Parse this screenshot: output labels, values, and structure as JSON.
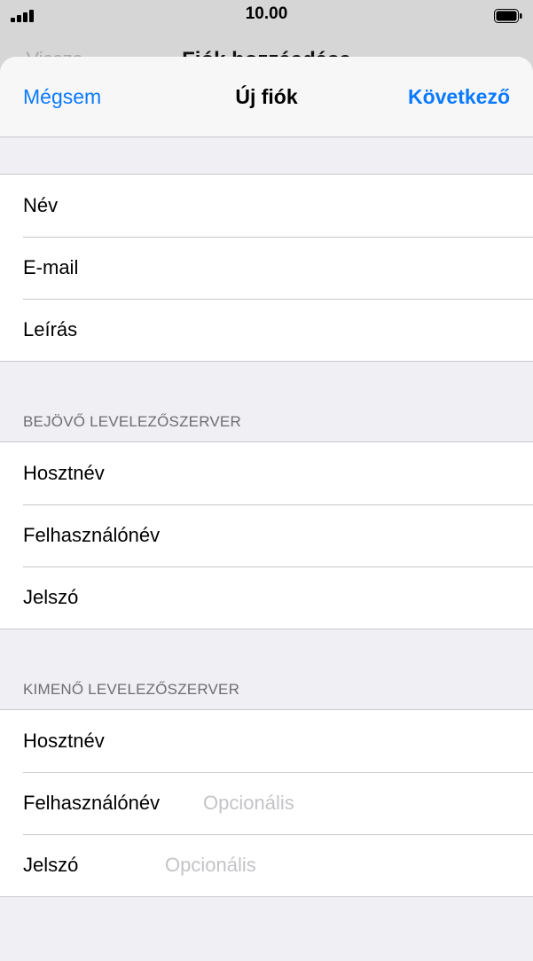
{
  "status_bar": {
    "time": "10.00",
    "signal_icon": "signal-bars-icon",
    "battery_icon": "battery-full-icon"
  },
  "background_nav": {
    "back_label": "Vissza",
    "title": "Fiók hozzáadása"
  },
  "sheet": {
    "cancel_label": "Mégsem",
    "title": "Új fiók",
    "next_label": "Következő"
  },
  "account_fields": [
    {
      "label": "Név",
      "placeholder": "",
      "value": ""
    },
    {
      "label": "E-mail",
      "placeholder": "",
      "value": ""
    },
    {
      "label": "Leírás",
      "placeholder": "",
      "value": ""
    }
  ],
  "incoming": {
    "header": "BEJÖVŐ LEVELEZŐSZERVER",
    "fields": [
      {
        "label": "Hosztnév",
        "placeholder": "",
        "value": ""
      },
      {
        "label": "Felhasználónév",
        "placeholder": "",
        "value": ""
      },
      {
        "label": "Jelszó",
        "placeholder": "",
        "value": ""
      }
    ]
  },
  "outgoing": {
    "header": "KIMENŐ LEVELEZŐSZERVER",
    "fields": [
      {
        "label": "Hosztnév",
        "placeholder": "",
        "value": ""
      },
      {
        "label": "Felhasználónév",
        "placeholder": "Opcionális",
        "value": ""
      },
      {
        "label": "Jelszó",
        "placeholder": "Opcionális",
        "value": ""
      }
    ]
  },
  "colors": {
    "accent": "#0a7aff",
    "background": "#efeff4",
    "separator": "#c8c7cc",
    "placeholder": "#c4c4c8"
  }
}
